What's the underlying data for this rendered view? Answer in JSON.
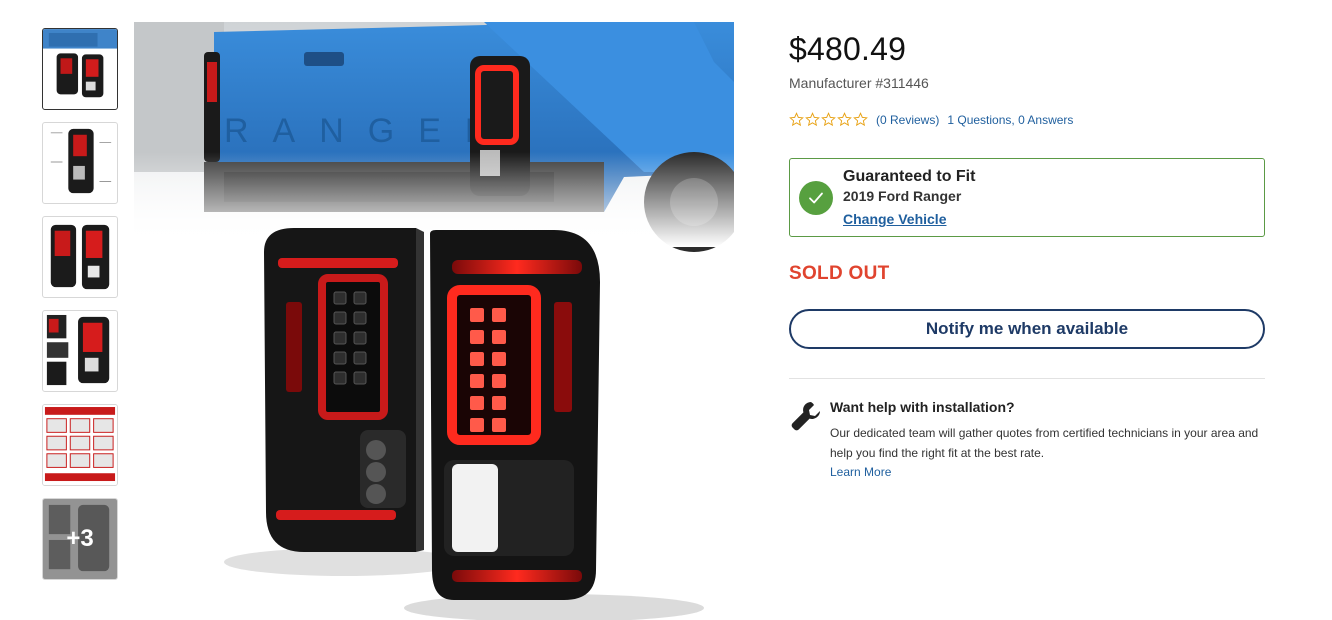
{
  "gallery": {
    "thumbnails": [
      {
        "name": "thumb-rear-view"
      },
      {
        "name": "thumb-lamp-dimensions"
      },
      {
        "name": "thumb-lamp-pair"
      },
      {
        "name": "thumb-lamp-parts"
      },
      {
        "name": "thumb-instructions"
      },
      {
        "name": "thumb-more"
      }
    ],
    "more_count": "+3"
  },
  "product": {
    "price": "$480.49",
    "manufacturer": "Manufacturer #311446",
    "reviews_link": "(0 Reviews)",
    "qa_link": "1 Questions, 0 Answers",
    "rating": 0,
    "stars_total": 5
  },
  "fitment": {
    "title": "Guaranteed to Fit",
    "vehicle": "2019 Ford Ranger",
    "change_label": "Change Vehicle"
  },
  "availability": {
    "status": "SOLD OUT",
    "notify_label": "Notify me when available"
  },
  "installation": {
    "title": "Want help with installation?",
    "description": "Our dedicated team will gather quotes from certified technicians in your area and help you find the right fit at the best rate.",
    "learn_more": "Learn More"
  },
  "colors": {
    "accent_blue": "#1f5f9e",
    "button_navy": "#1e3a66",
    "sold_out_red": "#e0442f",
    "fit_green": "#57a03f",
    "star_gold": "#e8a317"
  },
  "icons": [
    "check-icon",
    "star-icon",
    "wrench-icon"
  ]
}
